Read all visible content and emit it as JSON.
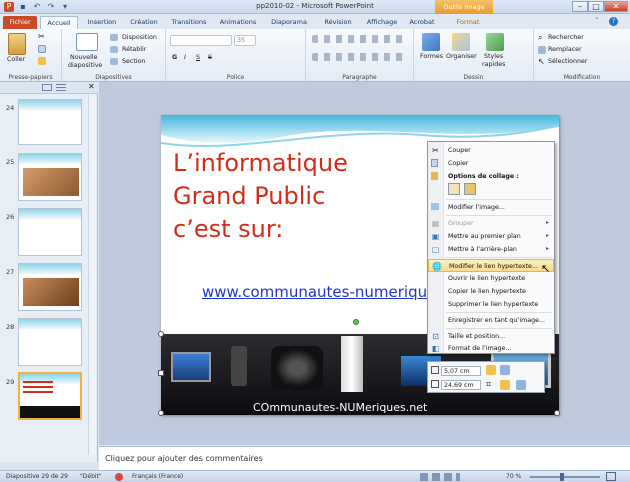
{
  "window": {
    "title": "pp2010-02 - Microsoft PowerPoint",
    "contextual_tab_group": "Outils Image"
  },
  "tabs": [
    "Fichier",
    "Accueil",
    "Insertion",
    "Création",
    "Transitions",
    "Animations",
    "Diaporama",
    "Révision",
    "Affichage",
    "Acrobat",
    "Format"
  ],
  "ribbon": {
    "presse_papiers": {
      "label": "Presse-papiers",
      "coller": "Coller"
    },
    "diapositives": {
      "label": "Diapositives",
      "nouvelle": "Nouvelle",
      "diapositive": "diapositive",
      "disposition": "Disposition",
      "retablir": "Rétablir",
      "section": "Section"
    },
    "police": {
      "label": "Police",
      "size": "35",
      "bold": "G",
      "italic": "I",
      "underline": "S",
      "strike": "S"
    },
    "paragraphe": {
      "label": "Paragraphe"
    },
    "dessin": {
      "label": "Dessin",
      "formes": "Formes",
      "organiser": "Organiser",
      "styles": "Styles",
      "rapides": "rapides"
    },
    "modification": {
      "label": "Modification",
      "rechercher": "Rechercher",
      "remplacer": "Remplacer",
      "selectionner": "Sélectionner"
    }
  },
  "thumbnails": [
    {
      "num": "24"
    },
    {
      "num": "25"
    },
    {
      "num": "26"
    },
    {
      "num": "27"
    },
    {
      "num": "28"
    },
    {
      "num": "29"
    }
  ],
  "slide": {
    "title_lines": [
      "L’informatique",
      "Grand Public",
      "c’est sur:"
    ],
    "link": "www.communautes-numeriques",
    "image_caption": "COmmunautes-NUMeriques.net"
  },
  "context_menu": {
    "items": [
      {
        "label": "Couper",
        "icon": "scissors-icon",
        "disabled": false
      },
      {
        "label": "Copier",
        "icon": "copy-icon",
        "disabled": false
      },
      {
        "label": "Options de collage :",
        "icon": "paste-icon",
        "disabled": false,
        "bold": true
      },
      {
        "label": "Modifier l’image...",
        "icon": "picture-icon",
        "disabled": false
      },
      {
        "label": "Grouper",
        "icon": "group-icon",
        "disabled": true,
        "arrow": true
      },
      {
        "label": "Mettre au premier plan",
        "icon": "bring-front-icon",
        "disabled": false,
        "arrow": true
      },
      {
        "label": "Mettre à l’arrière-plan",
        "icon": "send-back-icon",
        "disabled": false,
        "arrow": true
      },
      {
        "label": "Modifier le lien hypertexte...",
        "icon": "hyperlink-icon",
        "disabled": false,
        "highlight": true
      },
      {
        "label": "Ouvrir le lien hypertexte",
        "icon": "",
        "disabled": false
      },
      {
        "label": "Copier le lien hypertexte",
        "icon": "",
        "disabled": false
      },
      {
        "label": "Supprimer le lien hypertexte",
        "icon": "",
        "disabled": false
      },
      {
        "label": "Enregistrer en tant qu’image...",
        "icon": "",
        "disabled": false
      },
      {
        "label": "Taille et position...",
        "icon": "size-icon",
        "disabled": false
      },
      {
        "label": "Format de l’image...",
        "icon": "format-icon",
        "disabled": false
      }
    ]
  },
  "mini_toolbar": {
    "height": "5,07 cm",
    "width": "24,69 cm"
  },
  "notes": {
    "placeholder": "Cliquez pour ajouter des commentaires"
  },
  "statusbar": {
    "slide": "Diapositive 29 de 29",
    "theme": "\"Débit\"",
    "lang": "Français (France)",
    "zoom": "70 %"
  },
  "colors": {
    "file_tab": "#c94a26",
    "title_red": "#d42c1a",
    "link_blue": "#1f35c8",
    "highlight": "#f8dc8c"
  }
}
